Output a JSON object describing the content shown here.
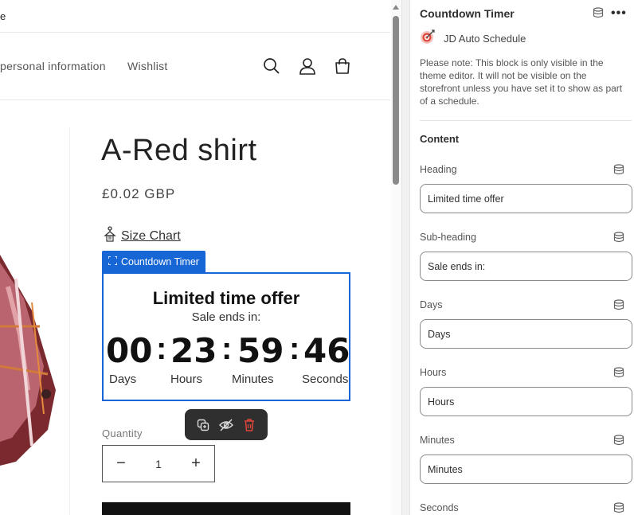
{
  "preview": {
    "top_cut_text": "e",
    "nav": [
      {
        "label": "personal information"
      },
      {
        "label": "Wishlist"
      }
    ],
    "header_icons": [
      "search-icon",
      "account-icon",
      "cart-icon"
    ],
    "product": {
      "title": "A-Red shirt",
      "price": "£0.02 GBP",
      "size_chart_label": "Size Chart"
    },
    "countdown": {
      "tag_label": "Countdown Timer",
      "heading": "Limited time offer",
      "subheading": "Sale ends in:",
      "values": {
        "days": "00",
        "hours": "23",
        "minutes": "59",
        "seconds": "46"
      },
      "separator": ":",
      "units": {
        "days": "Days",
        "hours": "Hours",
        "minutes": "Minutes",
        "seconds": "Seconds"
      }
    },
    "toolbar_icons": [
      "duplicate-icon",
      "hide-icon",
      "delete-icon"
    ],
    "quantity": {
      "label": "Quantity",
      "value": "1",
      "minus": "−",
      "plus": "+"
    }
  },
  "settings": {
    "title": "Countdown Timer",
    "more": "•••",
    "app_name": "JD Auto Schedule",
    "note": "Please note: This block is only visible in the theme editor. It will not be visible on the storefront unless you have set it to show as part of a schedule.",
    "section_title": "Content",
    "fields": [
      {
        "label": "Heading",
        "value": "Limited time offer"
      },
      {
        "label": "Sub-heading",
        "value": "Sale ends in:"
      },
      {
        "label": "Days",
        "value": "Days"
      },
      {
        "label": "Hours",
        "value": "Hours"
      },
      {
        "label": "Minutes",
        "value": "Minutes"
      },
      {
        "label": "Seconds",
        "value": ""
      }
    ]
  },
  "colors": {
    "accent": "#1766d6",
    "delete": "#e0453a",
    "toolbar_bg": "#2f2f2f"
  }
}
